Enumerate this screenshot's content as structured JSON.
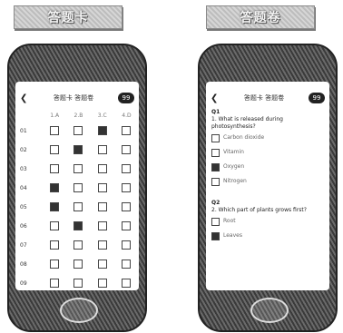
{
  "left": {
    "banner": "答题卡",
    "nav": {
      "back": "❮",
      "title": "答题卡  答题卷",
      "badge": "99"
    },
    "columns": [
      "",
      "1.A",
      "2.B",
      "3.C",
      "4.D"
    ],
    "rows": [
      {
        "label": "01",
        "checked": [
          false,
          false,
          true,
          false
        ]
      },
      {
        "label": "02",
        "checked": [
          false,
          true,
          false,
          false
        ]
      },
      {
        "label": "03",
        "checked": [
          false,
          false,
          false,
          false
        ]
      },
      {
        "label": "04",
        "checked": [
          true,
          false,
          false,
          false
        ]
      },
      {
        "label": "05",
        "checked": [
          true,
          false,
          false,
          false
        ]
      },
      {
        "label": "06",
        "checked": [
          false,
          true,
          false,
          false
        ]
      },
      {
        "label": "07",
        "checked": [
          false,
          false,
          false,
          false
        ]
      },
      {
        "label": "08",
        "checked": [
          false,
          false,
          false,
          false
        ]
      },
      {
        "label": "09",
        "checked": [
          false,
          false,
          false,
          false
        ]
      },
      {
        "label": "Q10",
        "checked": [
          false,
          false,
          false,
          false
        ]
      }
    ]
  },
  "right": {
    "banner": "答题卷",
    "nav": {
      "back": "❮",
      "title": "答题卡  答题卷",
      "badge": "99"
    },
    "questions": [
      {
        "num": "Q1",
        "text": "1. What is released during photosynthesis?",
        "options": [
          {
            "label": "Carbon dioxide",
            "checked": false
          },
          {
            "label": "Vitamin",
            "checked": false
          },
          {
            "label": "Oxygen",
            "checked": true
          },
          {
            "label": "Nitrogen",
            "checked": false
          }
        ]
      },
      {
        "num": "Q2",
        "text": "2. Which part of plants grows first?",
        "options": [
          {
            "label": "Root",
            "checked": false
          },
          {
            "label": "Leaves",
            "checked": true
          }
        ]
      }
    ]
  }
}
